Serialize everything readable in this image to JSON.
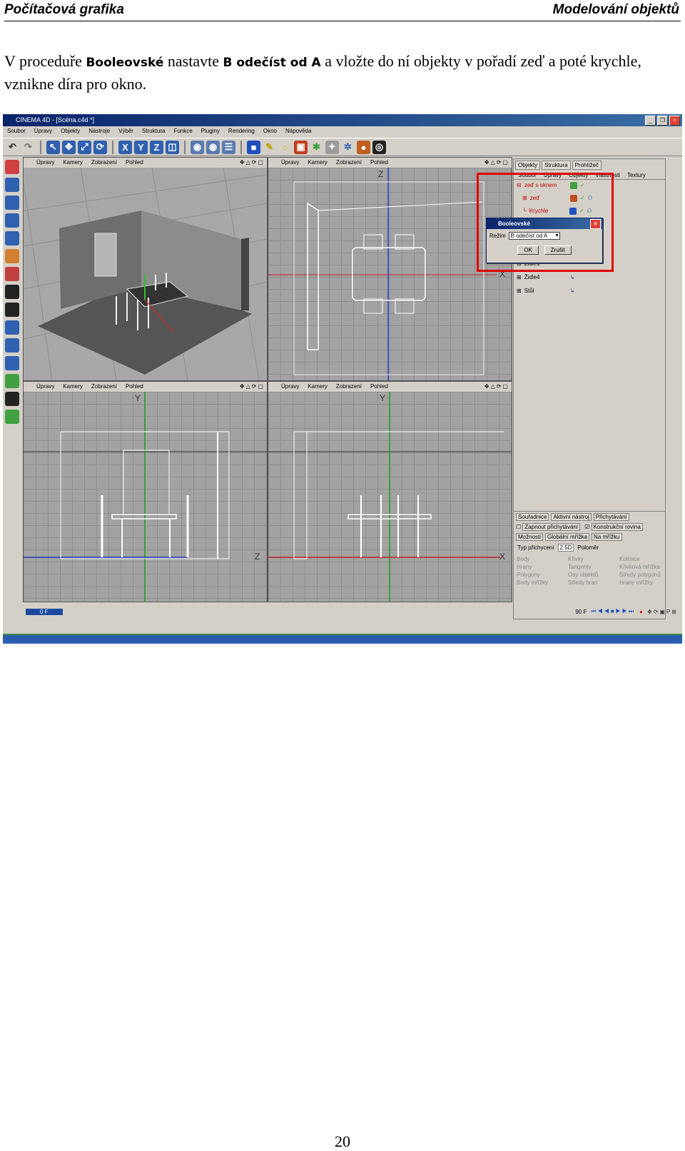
{
  "header": {
    "left": "Počítačová grafika",
    "right": "Modelování objektů"
  },
  "paragraph": {
    "t1": "V proceduře ",
    "b1": "Booleovské",
    "t2": " nastavte ",
    "b2": "B odečíst od A",
    "t3": " a vložte do ní objekty v pořadí zeď a poté krychle, vznikne díra pro okno."
  },
  "screenshot": {
    "window_title": "CINEMA 4D - [Scéna.c4d *]",
    "menu": [
      "Soubor",
      "Úpravy",
      "Objekty",
      "Nástroje",
      "Výběr",
      "Struktura",
      "Funkce",
      "Pluginy",
      "Rendering",
      "Okno",
      "Nápověda"
    ],
    "viewport_menu": [
      "Úpravy",
      "Kamery",
      "Zobrazení",
      "Pohled"
    ],
    "viewport_label": "Pohled",
    "axis_labels": {
      "x": "X",
      "y": "Y",
      "z": "Z"
    },
    "object_manager": {
      "tabs": [
        "Objekty",
        "Struktura",
        "Prohlížeč"
      ],
      "menu": [
        "Soubor",
        "Úpravy",
        "Objekty",
        "Vlastnosti",
        "Textury"
      ],
      "objects": [
        "zeď s oknem",
        "zeď",
        "Krychle",
        "Židle1",
        "Židle4",
        "Stůl"
      ]
    },
    "dialog": {
      "title": "Booleovské",
      "mode_label": "Režim",
      "mode_value": "B odečíst od A",
      "ok": "OK",
      "cancel": "Zrušit"
    },
    "attributes": {
      "tabs": [
        "Souřadnice",
        "Aktivní nástroj",
        "Přichytávání"
      ],
      "check1": "Zapnout přichytávání",
      "check2": "Konstrukční rovina",
      "subtabs": [
        "Možnosti",
        "Globální mřížka",
        "Na mřížku"
      ],
      "snap_type_label": "Typ přichycení",
      "snap_type_value": "2.5D",
      "radius_label": "Poloměr",
      "options": [
        "Body",
        "Křivky",
        "Kolmice",
        "Hrany",
        "Tangenty",
        "Křivková mřížka",
        "Polygony",
        "Osy objektů",
        "Středy polygonů",
        "Body mřížky",
        "Středy hran",
        "Hrany mřížky"
      ]
    },
    "timeline": {
      "start": "0 F",
      "end": "90 F"
    }
  },
  "page_number": "20"
}
